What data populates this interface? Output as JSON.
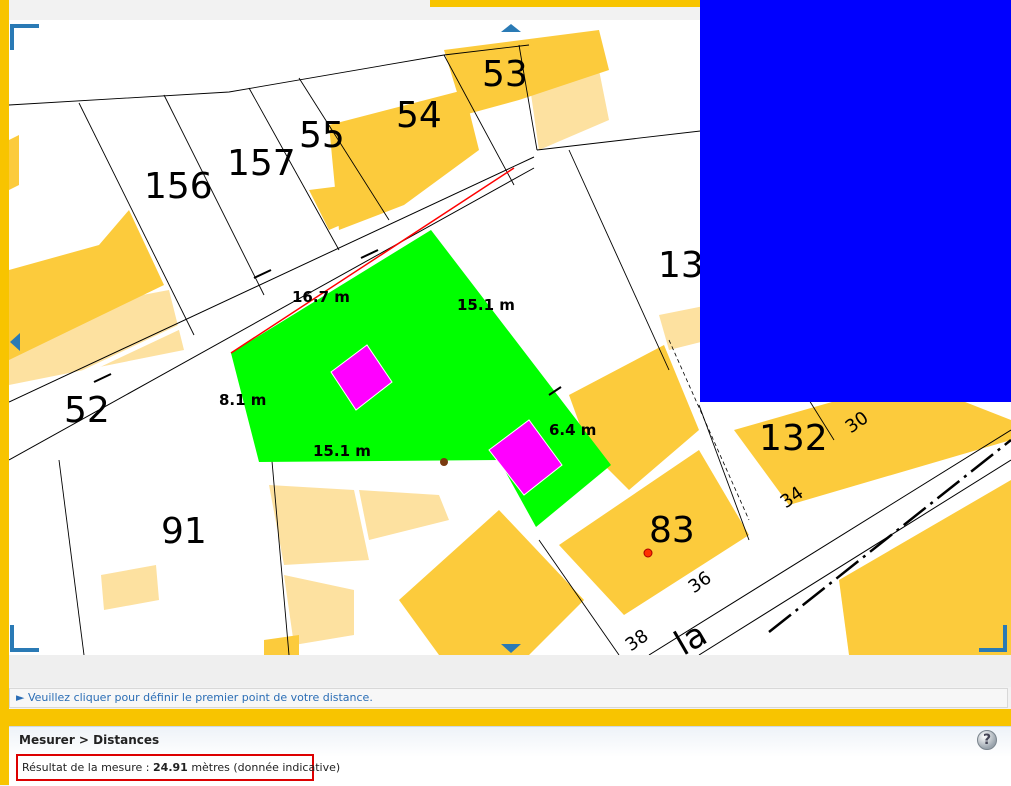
{
  "map": {
    "parcel_numbers": [
      "53",
      "54",
      "55",
      "157",
      "156",
      "52",
      "91",
      "83",
      "132",
      "13"
    ],
    "small_numbers": [
      "30",
      "34",
      "36",
      "38"
    ],
    "street_label": "la",
    "measurements": [
      "16.7 m",
      "15.1 m",
      "8.1 m",
      "15.1 m",
      "6.4 m"
    ],
    "colors": {
      "building": "#fccb3c",
      "building_light": "#fde1a0",
      "selected_parcel": "#00ff00",
      "marker_shape": "#ff00ff",
      "measure_line": "#ff0000",
      "overlay": "#0000ff",
      "handles": "#2a7ab5"
    }
  },
  "instruction": {
    "icon": "play-triangle-icon",
    "text": "► Veuillez cliquer pour définir le premier point de votre distance."
  },
  "panel": {
    "breadcrumb": "Mesurer > Distances",
    "help_icon": "help-question-icon",
    "help_label": "?",
    "result_prefix": "Résultat de la mesure :",
    "result_value": "24.91",
    "result_suffix": "mètres (donnée indicative)"
  }
}
